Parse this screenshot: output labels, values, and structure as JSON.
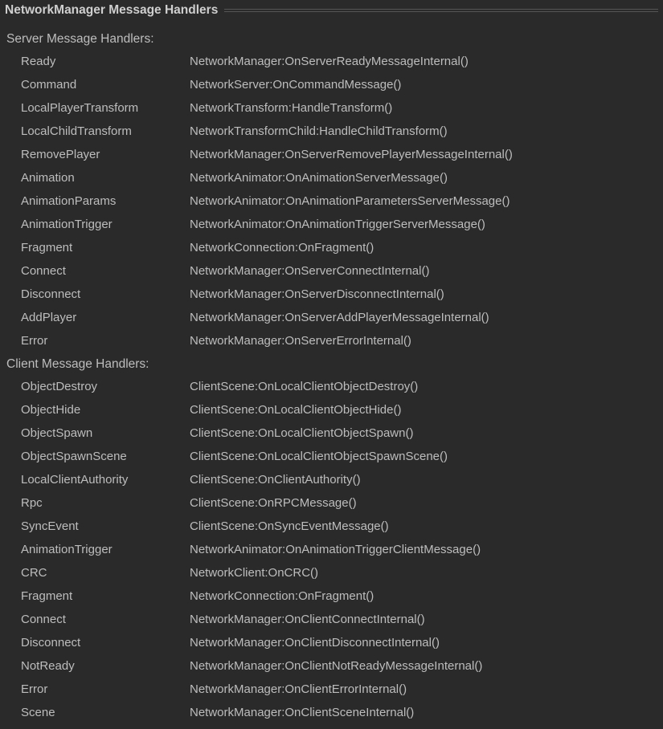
{
  "panel": {
    "title": "NetworkManager Message Handlers"
  },
  "sections": {
    "server": {
      "heading": "Server Message Handlers:",
      "items": [
        {
          "label": "Ready",
          "value": "NetworkManager:OnServerReadyMessageInternal()"
        },
        {
          "label": "Command",
          "value": "NetworkServer:OnCommandMessage()"
        },
        {
          "label": "LocalPlayerTransform",
          "value": "NetworkTransform:HandleTransform()"
        },
        {
          "label": "LocalChildTransform",
          "value": "NetworkTransformChild:HandleChildTransform()"
        },
        {
          "label": "RemovePlayer",
          "value": "NetworkManager:OnServerRemovePlayerMessageInternal()"
        },
        {
          "label": "Animation",
          "value": "NetworkAnimator:OnAnimationServerMessage()"
        },
        {
          "label": "AnimationParams",
          "value": "NetworkAnimator:OnAnimationParametersServerMessage()"
        },
        {
          "label": "AnimationTrigger",
          "value": "NetworkAnimator:OnAnimationTriggerServerMessage()"
        },
        {
          "label": "Fragment",
          "value": "NetworkConnection:OnFragment()"
        },
        {
          "label": "Connect",
          "value": "NetworkManager:OnServerConnectInternal()"
        },
        {
          "label": "Disconnect",
          "value": "NetworkManager:OnServerDisconnectInternal()"
        },
        {
          "label": "AddPlayer",
          "value": "NetworkManager:OnServerAddPlayerMessageInternal()"
        },
        {
          "label": "Error",
          "value": "NetworkManager:OnServerErrorInternal()"
        }
      ]
    },
    "client": {
      "heading": "Client Message Handlers:",
      "items": [
        {
          "label": "ObjectDestroy",
          "value": "ClientScene:OnLocalClientObjectDestroy()"
        },
        {
          "label": "ObjectHide",
          "value": "ClientScene:OnLocalClientObjectHide()"
        },
        {
          "label": "ObjectSpawn",
          "value": "ClientScene:OnLocalClientObjectSpawn()"
        },
        {
          "label": "ObjectSpawnScene",
          "value": "ClientScene:OnLocalClientObjectSpawnScene()"
        },
        {
          "label": "LocalClientAuthority",
          "value": "ClientScene:OnClientAuthority()"
        },
        {
          "label": "Rpc",
          "value": "ClientScene:OnRPCMessage()"
        },
        {
          "label": "SyncEvent",
          "value": "ClientScene:OnSyncEventMessage()"
        },
        {
          "label": "AnimationTrigger",
          "value": "NetworkAnimator:OnAnimationTriggerClientMessage()"
        },
        {
          "label": "CRC",
          "value": "NetworkClient:OnCRC()"
        },
        {
          "label": "Fragment",
          "value": "NetworkConnection:OnFragment()"
        },
        {
          "label": "Connect",
          "value": "NetworkManager:OnClientConnectInternal()"
        },
        {
          "label": "Disconnect",
          "value": "NetworkManager:OnClientDisconnectInternal()"
        },
        {
          "label": "NotReady",
          "value": "NetworkManager:OnClientNotReadyMessageInternal()"
        },
        {
          "label": "Error",
          "value": "NetworkManager:OnClientErrorInternal()"
        },
        {
          "label": "Scene",
          "value": "NetworkManager:OnClientSceneInternal()"
        }
      ]
    }
  }
}
